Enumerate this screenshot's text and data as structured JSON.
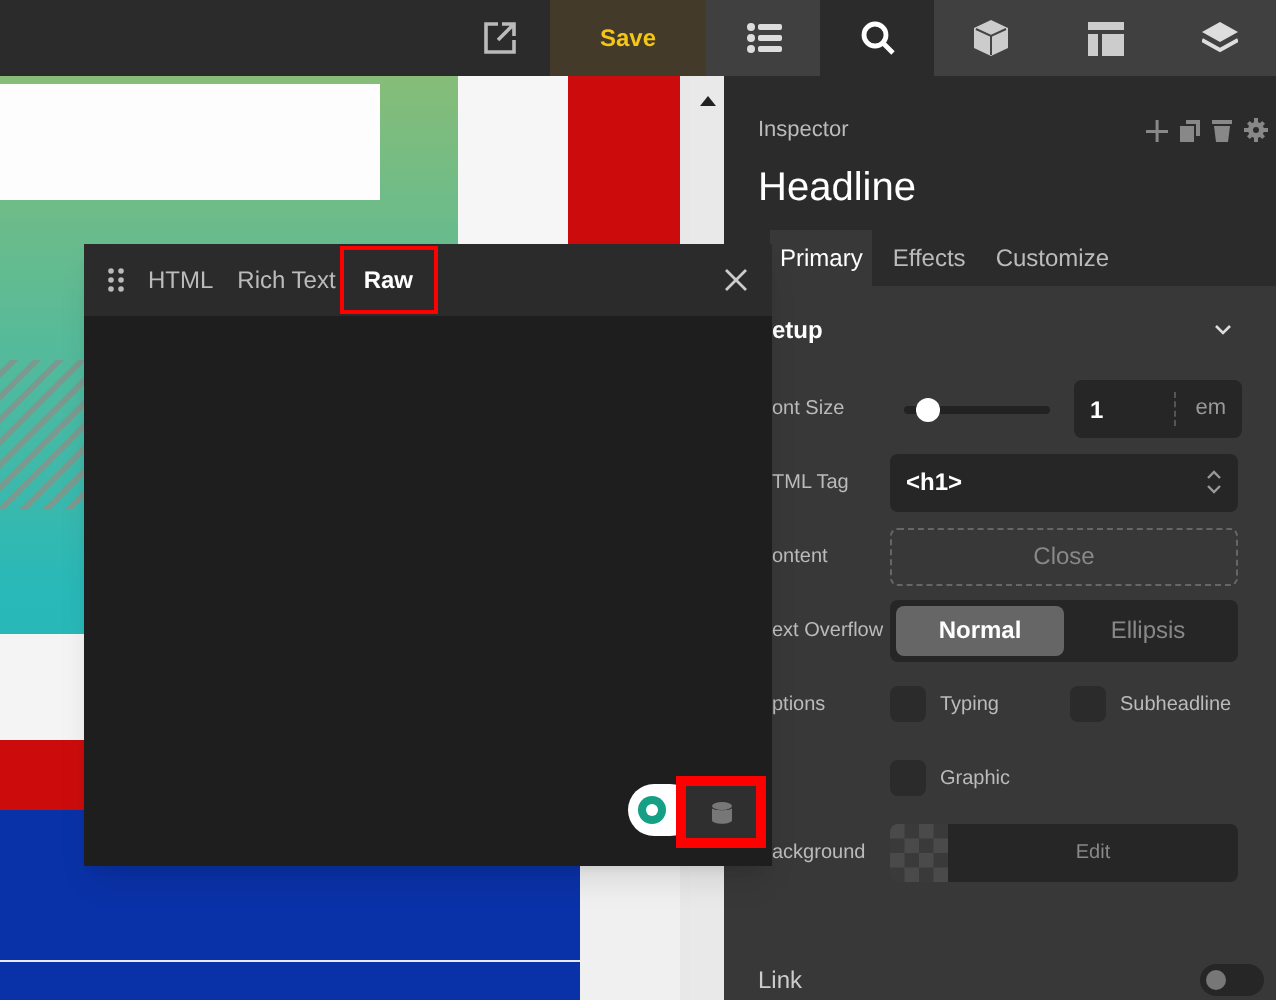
{
  "toolbar": {
    "save": "Save",
    "panels": [
      {
        "kind": "list",
        "selected": false
      },
      {
        "kind": "search",
        "selected": true
      },
      {
        "kind": "cube",
        "selected": false
      },
      {
        "kind": "layout",
        "selected": false
      },
      {
        "kind": "layers",
        "selected": false
      }
    ]
  },
  "editor_modal": {
    "tabs": [
      {
        "label": "HTML",
        "selected": false
      },
      {
        "label": "Rich Text",
        "selected": false
      },
      {
        "label": "Raw",
        "selected": true
      }
    ]
  },
  "inspector": {
    "title": "Inspector",
    "heading": "Headline",
    "tabs": [
      {
        "label": "Primary",
        "selected": true
      },
      {
        "label": "Effects",
        "selected": false
      },
      {
        "label": "Customize",
        "selected": false
      }
    ],
    "section": {
      "title": "etup",
      "expanded": true
    },
    "font_size": {
      "label": "ont Size",
      "level": 0.11,
      "value": "1",
      "unit": "em"
    },
    "html_tag": {
      "label": "TML Tag",
      "value": "<h1>"
    },
    "content": {
      "label": "ontent",
      "button": "Close"
    },
    "text_overflow": {
      "label": "ext Overflow",
      "options": [
        {
          "label": "Normal",
          "selected": true
        },
        {
          "label": "Ellipsis",
          "selected": false
        }
      ]
    },
    "options": {
      "label": "ptions",
      "items": [
        {
          "label": "Typing",
          "checked": false
        },
        {
          "label": "Subheadline",
          "checked": false
        },
        {
          "label": "Graphic",
          "checked": false
        }
      ]
    },
    "background": {
      "label": "ackground",
      "button": "Edit"
    },
    "link": {
      "label": "Link",
      "on": false
    }
  }
}
